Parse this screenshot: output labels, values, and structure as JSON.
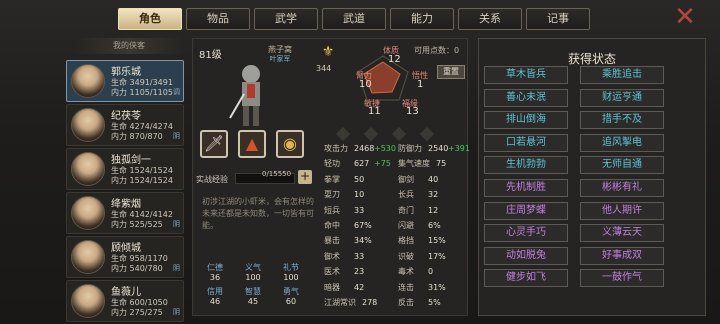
{
  "tabs": [
    {
      "label": "角色"
    },
    {
      "label": "物品"
    },
    {
      "label": "武学"
    },
    {
      "label": "武道"
    },
    {
      "label": "能力"
    },
    {
      "label": "关系"
    },
    {
      "label": "记事"
    }
  ],
  "close_icon": "close-x-icon",
  "list_header": "我的侠客",
  "characters": [
    {
      "name": "郭乐城",
      "hp": "生命 3491/3491",
      "mp": "内力 1105/1105",
      "tag": "调",
      "selected": true
    },
    {
      "name": "纪茯苓",
      "hp": "生命 4274/4274",
      "mp": "内力 870/870",
      "tag": "阴"
    },
    {
      "name": "独孤剑一",
      "hp": "生命 1524/1524",
      "mp": "内力 1524/1524",
      "tag": ""
    },
    {
      "name": "绛紫烟",
      "hp": "生命 4142/4142",
      "mp": "内力 525/525",
      "tag": "阴"
    },
    {
      "name": "顾倾城",
      "hp": "生命 958/1170",
      "mp": "内力 540/780",
      "tag": "阴"
    },
    {
      "name": "鱼薇儿",
      "hp": "生命 600/1050",
      "mp": "内力 275/275",
      "tag": "阴"
    }
  ],
  "detail": {
    "level": "81级",
    "sect": "燕子窝",
    "sect_sub": "叶家军",
    "fame": "344",
    "points": "可用点数：0",
    "reset": "重置",
    "attrs": {
      "tizhi": "体质",
      "tizhi_v": "12",
      "biliang": "臂力",
      "biliang_v": "10",
      "wuxing": "悟性",
      "wuxing_v": "1",
      "minjie": "敏捷",
      "minjie_v": "11",
      "fuyuan": "福缘",
      "fuyuan_v": "13"
    },
    "xp_label": "实战经验",
    "xp_value": "0/15550",
    "desc": "初涉江湖的小虾米，会有怎样的未来还都是未知数，一切皆有可能。",
    "virtues": [
      {
        "l": "仁德",
        "v": "36"
      },
      {
        "l": "义气",
        "v": "100"
      },
      {
        "l": "礼节",
        "v": "100"
      },
      {
        "l": "信用",
        "v": "46"
      },
      {
        "l": "智慧",
        "v": "45"
      },
      {
        "l": "勇气",
        "v": "60"
      }
    ],
    "stats_left": [
      {
        "k": "攻击力",
        "v": "2468",
        "b": "+530"
      },
      {
        "k": "轻功",
        "v": "627",
        "b": "+75"
      },
      {
        "k": "拳掌",
        "v": "50"
      },
      {
        "k": "耍刀",
        "v": "10"
      },
      {
        "k": "短兵",
        "v": "33"
      },
      {
        "k": "命中",
        "v": "67%"
      },
      {
        "k": "暴击",
        "v": "34%"
      },
      {
        "k": "御术",
        "v": "33"
      },
      {
        "k": "医术",
        "v": "23"
      },
      {
        "k": "暗器",
        "v": "42"
      },
      {
        "k": "江湖常识",
        "v": "278"
      }
    ],
    "stats_right": [
      {
        "k": "防御力",
        "v": "2540",
        "b": "+391"
      },
      {
        "k": "集气速度",
        "v": "75"
      },
      {
        "k": "御剑",
        "v": "40"
      },
      {
        "k": "长兵",
        "v": "32"
      },
      {
        "k": "奇门",
        "v": "12"
      },
      {
        "k": "闪避",
        "v": "6%"
      },
      {
        "k": "格挡",
        "v": "15%"
      },
      {
        "k": "识破",
        "v": "17%"
      },
      {
        "k": "毒术",
        "v": "0"
      },
      {
        "k": "连击",
        "v": "31%"
      },
      {
        "k": "反击",
        "v": "5%"
      }
    ]
  },
  "status": {
    "title": "获得状态",
    "chips": [
      {
        "label": "草木皆兵",
        "tone": "cyan"
      },
      {
        "label": "乘胜追击",
        "tone": "cyan"
      },
      {
        "label": "善心未泯",
        "tone": "cyan"
      },
      {
        "label": "财运亨通",
        "tone": "cyan"
      },
      {
        "label": "排山倒海",
        "tone": "cyan"
      },
      {
        "label": "措手不及",
        "tone": "cyan"
      },
      {
        "label": "口若悬河",
        "tone": "cyan"
      },
      {
        "label": "追风掣电",
        "tone": "cyan"
      },
      {
        "label": "生机勃勃",
        "tone": "cyan"
      },
      {
        "label": "无师自通",
        "tone": "cyan"
      },
      {
        "label": "先机制胜",
        "tone": "purp"
      },
      {
        "label": "彬彬有礼",
        "tone": "purp"
      },
      {
        "label": "庄周梦蝶",
        "tone": "purp"
      },
      {
        "label": "他人期许",
        "tone": "purp"
      },
      {
        "label": "心灵手巧",
        "tone": "purp"
      },
      {
        "label": "义薄云天",
        "tone": "purp"
      },
      {
        "label": "动如脱兔",
        "tone": "purp"
      },
      {
        "label": "好事成双",
        "tone": "purp"
      },
      {
        "label": "健步如飞",
        "tone": "purp"
      },
      {
        "label": "一鼓作气",
        "tone": "purp"
      }
    ]
  },
  "colors": {
    "accent": "#f1e3bf",
    "cyan": "#5cc3d8",
    "purple": "#c47fe3",
    "bonus": "#46c764"
  }
}
